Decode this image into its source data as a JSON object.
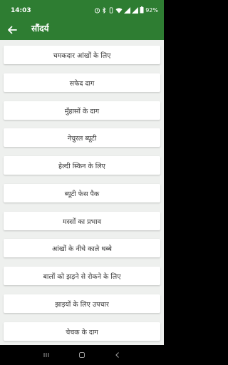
{
  "status": {
    "time": "14:03",
    "battery": "92%"
  },
  "header": {
    "title": "सौंदर्य"
  },
  "items": [
    "चमकदार आंखों के लिए",
    "सफेद दाग",
    "मुँहासों के दाग",
    "नेचुरल ब्यूटी",
    "हेल्दी स्किन के लिए",
    "ब्यूटी फेस पैक",
    "मस्सों का प्रभाव",
    "आंखों के नीचे काले धब्बे",
    "बालों को झड़ने से रोकने के लिए",
    "झाइयों के लिए उपचार",
    "चेचक के दाग"
  ],
  "colors": {
    "appbar": "#2e7d32",
    "background": "#eef0ee"
  }
}
